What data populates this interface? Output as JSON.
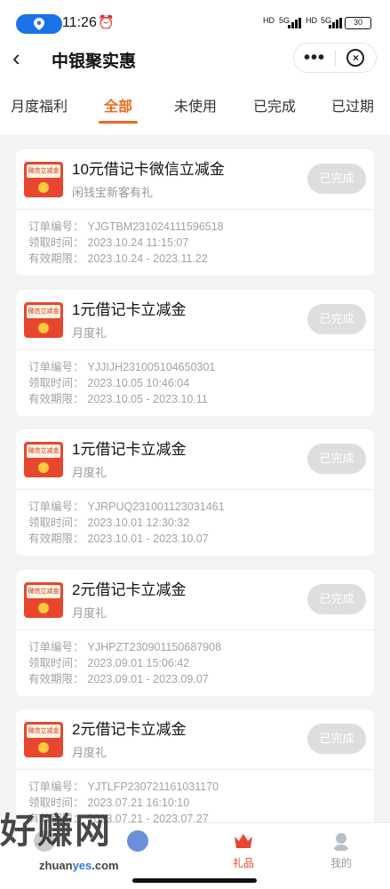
{
  "status": {
    "time": "11:26",
    "battery": "30",
    "net1": "5G",
    "net2": "5G",
    "hd": "HD"
  },
  "header": {
    "title": "中银聚实惠",
    "back": "‹",
    "more": "•••",
    "close": "×"
  },
  "tabs": [
    "月度福利",
    "全部",
    "未使用",
    "已完成",
    "已过期"
  ],
  "active_tab": "全部",
  "cards": [
    {
      "envelope": "微信立减金",
      "name": "10元借记卡微信立减金",
      "sub": "闲钱宝新客有礼",
      "status": "已完成",
      "order_label": "订单编号：",
      "order": "YJGTBM231024111596518",
      "claim_label": "领取时间：",
      "claim": "2023.10.24 11:15:07",
      "valid_label": "有效期限：",
      "valid": "2023.10.24 - 2023.11.22"
    },
    {
      "envelope": "微信立减金",
      "name": "1元借记卡立减金",
      "sub": "月度礼",
      "status": "已完成",
      "order_label": "订单编号：",
      "order": "YJJIJH231005104650301",
      "claim_label": "领取时间：",
      "claim": "2023.10.05 10:46:04",
      "valid_label": "有效期限：",
      "valid": "2023.10.05 - 2023.10.11"
    },
    {
      "envelope": "微信立减金",
      "name": "1元借记卡立减金",
      "sub": "月度礼",
      "status": "已完成",
      "order_label": "订单编号：",
      "order": "YJRPUQ231001123031461",
      "claim_label": "领取时间：",
      "claim": "2023.10.01 12:30:32",
      "valid_label": "有效期限：",
      "valid": "2023.10.01 - 2023.10.07"
    },
    {
      "envelope": "微信立减金",
      "name": "2元借记卡立减金",
      "sub": "月度礼",
      "status": "已完成",
      "order_label": "订单编号：",
      "order": "YJHPZT230901150687908",
      "claim_label": "领取时间：",
      "claim": "2023.09.01 15:06:42",
      "valid_label": "有效期限：",
      "valid": "2023.09.01 - 2023.09.07"
    },
    {
      "envelope": "微信立减金",
      "name": "2元借记卡立减金",
      "sub": "月度礼",
      "status": "已完成",
      "order_label": "订单编号：",
      "order": "YJTLFP230721161031170",
      "claim_label": "领取时间：",
      "claim": "2023.07.21 16:10:10",
      "valid_label": "有效期限：",
      "valid": "2023.07.21 - 2023.07.27"
    }
  ],
  "nav": {
    "gift": "礼品",
    "mine": "我的"
  },
  "watermark": {
    "text": "好赚网",
    "url_a": "zhuan",
    "url_b": "yes",
    "url_c": ".com"
  },
  "colors": {
    "accent": "#ee6a1c",
    "envelope": "#e8462f",
    "done_button": "#dedede"
  }
}
